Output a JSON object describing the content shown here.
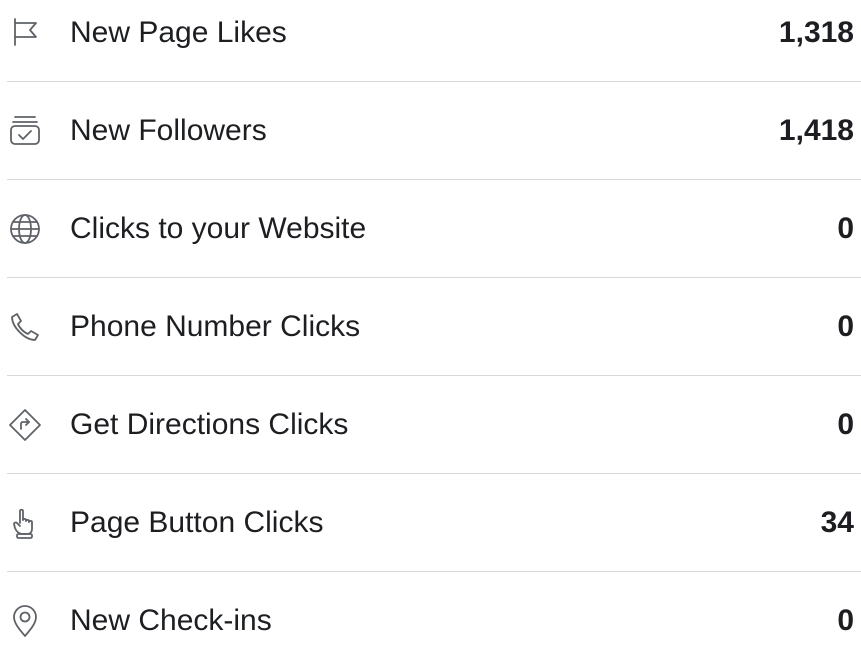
{
  "stats": [
    {
      "icon": "flag-icon",
      "label": "New Page Likes",
      "value": "1,318"
    },
    {
      "icon": "follow-icon",
      "label": "New Followers",
      "value": "1,418"
    },
    {
      "icon": "globe-icon",
      "label": "Clicks to your Website",
      "value": "0"
    },
    {
      "icon": "phone-icon",
      "label": "Phone Number Clicks",
      "value": "0"
    },
    {
      "icon": "directions-icon",
      "label": "Get Directions Clicks",
      "value": "0"
    },
    {
      "icon": "hand-pointer-icon",
      "label": "Page Button Clicks",
      "value": "34"
    },
    {
      "icon": "location-pin-icon",
      "label": "New Check-ins",
      "value": "0"
    }
  ],
  "colors": {
    "text": "#1c1e21",
    "icon": "#5f6368",
    "divider": "#d7d8dc",
    "background": "#ffffff"
  }
}
